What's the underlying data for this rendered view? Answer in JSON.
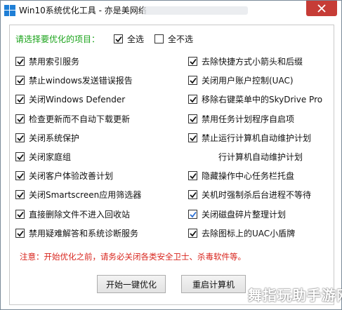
{
  "window": {
    "title": "Win10系统优化工具 - 亦是美网络"
  },
  "header": {
    "prompt": "请选择要优化的项目：",
    "select_all": "全选",
    "select_none": "全不选",
    "select_all_checked": true,
    "select_none_checked": false
  },
  "options": {
    "left": [
      {
        "label": "禁用索引服务",
        "checked": true
      },
      {
        "label": "禁止windows发送错误报告",
        "checked": true
      },
      {
        "label": "关闭Windows Defender",
        "checked": true
      },
      {
        "label": "检查更新而不自动下载更新",
        "checked": true
      },
      {
        "label": "关闭系统保护",
        "checked": true
      },
      {
        "label": "关闭家庭组",
        "checked": true
      },
      {
        "label": "关闭客户体验改善计划",
        "checked": true
      },
      {
        "label": "关闭Smartscreen应用筛选器",
        "checked": true
      },
      {
        "label": "直接删除文件不进入回收站",
        "checked": true
      },
      {
        "label": "禁用疑难解答和系统诊断服务",
        "checked": true
      }
    ],
    "right": [
      {
        "label": "去除快捷方式小箭头和后缀",
        "checked": true
      },
      {
        "label": "关闭用户账户控制(UAC)",
        "checked": true
      },
      {
        "label": "移除右键菜单中的SkyDrive Pro",
        "checked": true
      },
      {
        "label": "禁用任务计划程序自启项",
        "checked": true
      },
      {
        "label": "禁止运行计算机自动维护计划",
        "checked": true
      },
      {
        "label": "行计算机自动维护计划",
        "checked": null
      },
      {
        "label": "隐藏操作中心任务栏托盘",
        "checked": true
      },
      {
        "label": "关机时强制杀后台进程不等待",
        "checked": true
      },
      {
        "label": "关闭磁盘碎片整理计划",
        "checked": true
      },
      {
        "label": "去除图标上的UAC小盾牌",
        "checked": true
      }
    ]
  },
  "notice": "注意：开始优化之前，请务必关闭各类安全卫士、杀毒软件等。",
  "buttons": {
    "start": "开始一键优化",
    "restart": "重启计算机"
  },
  "watermark": "舞指玩助手游网",
  "colors": {
    "green": "#1aa31a",
    "notice_red": "#d8241c",
    "close_red": "#c63c36",
    "check_blue": "#2a6fd6"
  }
}
